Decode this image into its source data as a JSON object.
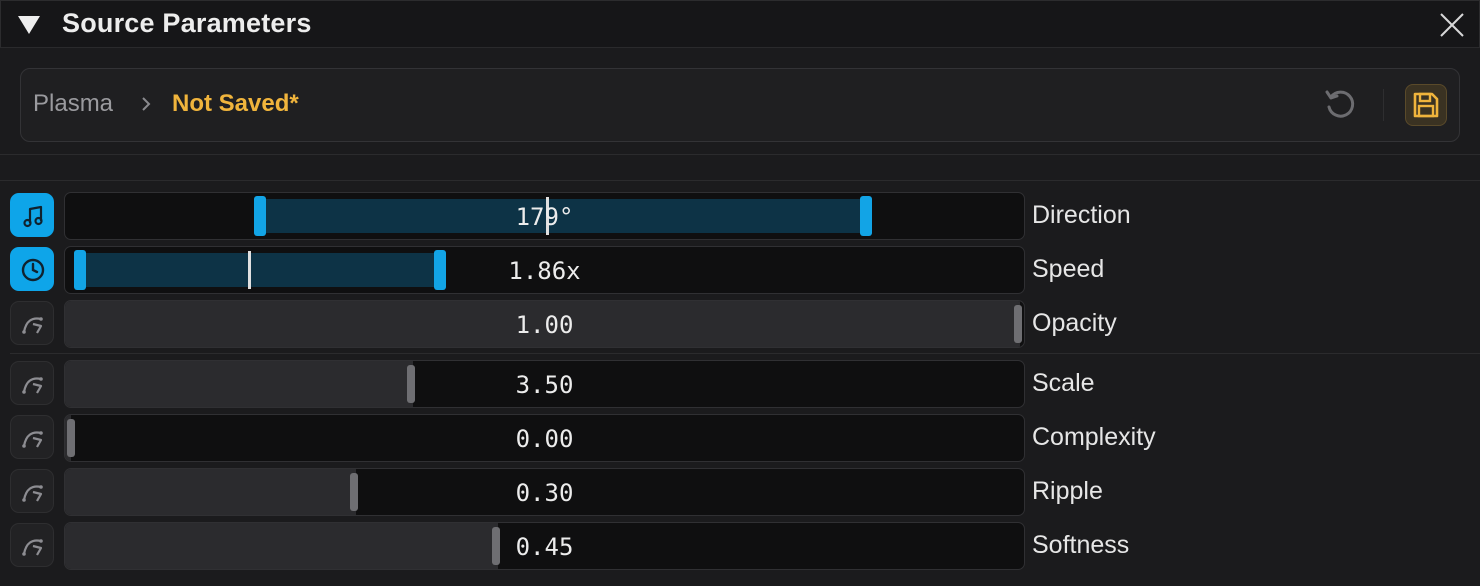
{
  "panel": {
    "title": "Source Parameters"
  },
  "preset": {
    "root": "Plasma",
    "current": "Not Saved*"
  },
  "colors": {
    "accent": "#0ea5e9",
    "warning": "#f0b43c"
  },
  "params": [
    {
      "label": "Direction",
      "value": "179°",
      "modulation": "music-note-icon",
      "active": true,
      "range_start": 0.2,
      "range_end": 0.84,
      "current": 0.5
    },
    {
      "label": "Speed",
      "value": "1.86x",
      "modulation": "clock-icon",
      "active": true,
      "range_start": 0.01,
      "range_end": 0.39,
      "current": 0.19
    },
    {
      "label": "Opacity",
      "value": "1.00",
      "modulation": "curve-icon",
      "active": false,
      "level": 1.0
    },
    {
      "label": "Scale",
      "value": "3.50",
      "modulation": "curve-icon",
      "active": false,
      "level": 0.36
    },
    {
      "label": "Complexity",
      "value": "0.00",
      "modulation": "curve-icon",
      "active": false,
      "level": 0.0
    },
    {
      "label": "Ripple",
      "value": "0.30",
      "modulation": "curve-icon",
      "active": false,
      "level": 0.3
    },
    {
      "label": "Softness",
      "value": "0.45",
      "modulation": "curve-icon",
      "active": false,
      "level": 0.45
    }
  ]
}
